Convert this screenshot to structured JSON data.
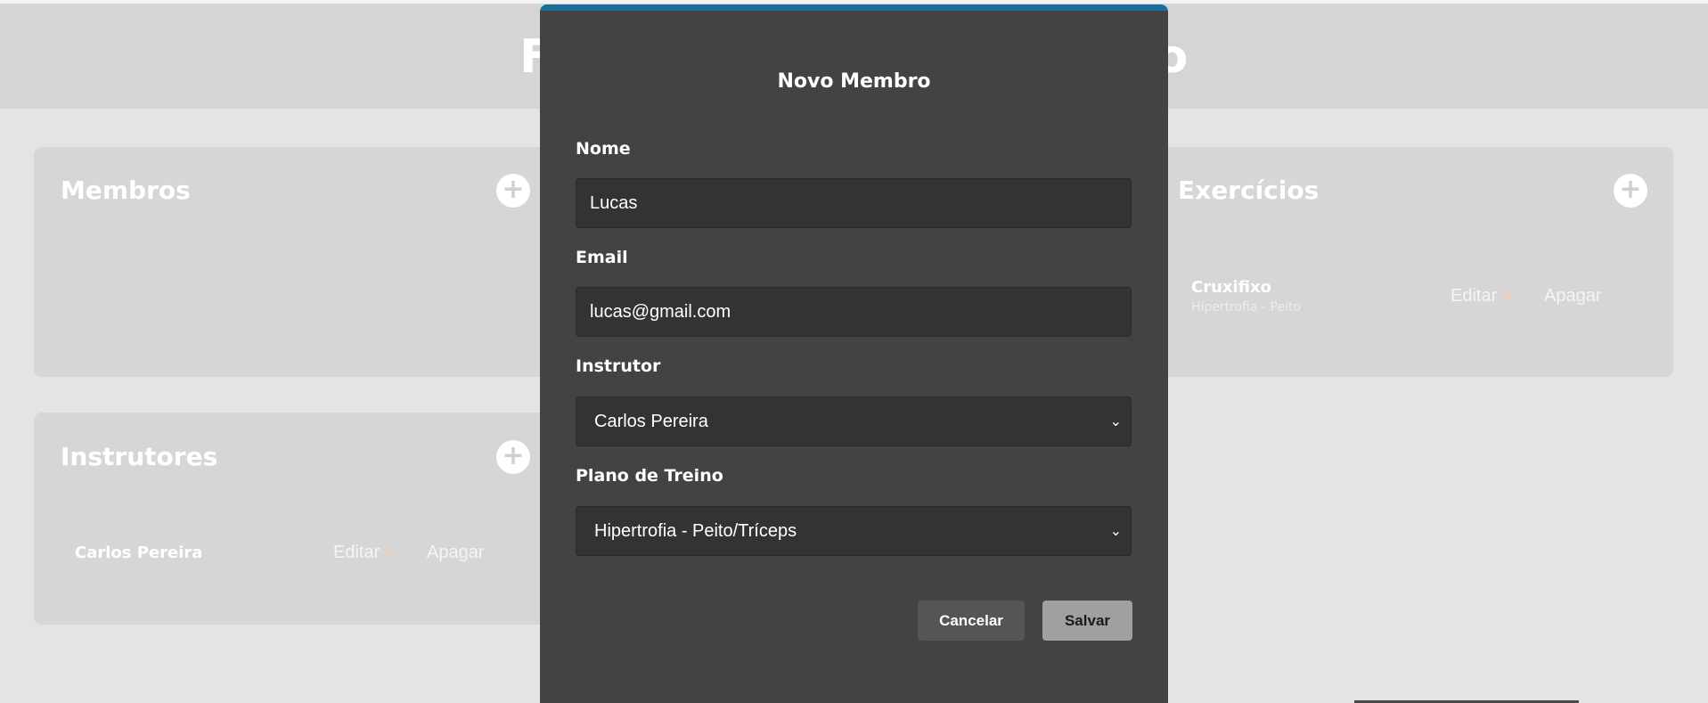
{
  "app": {
    "title": "FitCenter Gerenciamento"
  },
  "members": {
    "title": "Membros",
    "add_icon": "+"
  },
  "instructors": {
    "title": "Instrutores",
    "add_icon": "+",
    "items": [
      {
        "name": "Carlos Pereira",
        "edit_label": "Editar",
        "delete_label": "Apagar"
      }
    ]
  },
  "exercises": {
    "title": "Exercícios",
    "add_icon": "+",
    "items": [
      {
        "name": "Cruxifixo",
        "subtitle": "Hipertrofia - Peito",
        "edit_label": "Editar",
        "delete_label": "Apagar"
      }
    ]
  },
  "icons": {
    "edit": "pencil-icon",
    "delete": "trash-icon",
    "add": "plus-icon",
    "dropdown": "chevron-down-icon"
  },
  "modal": {
    "title": "Novo Membro",
    "name_label": "Nome",
    "name_value": "Lucas",
    "email_label": "Email",
    "email_value": "lucas@gmail.com",
    "instructor_label": "Instrutor",
    "instructor_value": "Carlos Pereira",
    "plan_label": "Plano de Treino",
    "plan_value": "Hipertrofia - Peito/Tríceps",
    "cancel_label": "Cancelar",
    "save_label": "Salvar"
  },
  "colors": {
    "modal_bg": "#434343",
    "modal_accent": "#1a6e9a",
    "field_bg": "#333333",
    "page_bg": "#e4e4e4",
    "card_bg": "#d6d6d6"
  }
}
